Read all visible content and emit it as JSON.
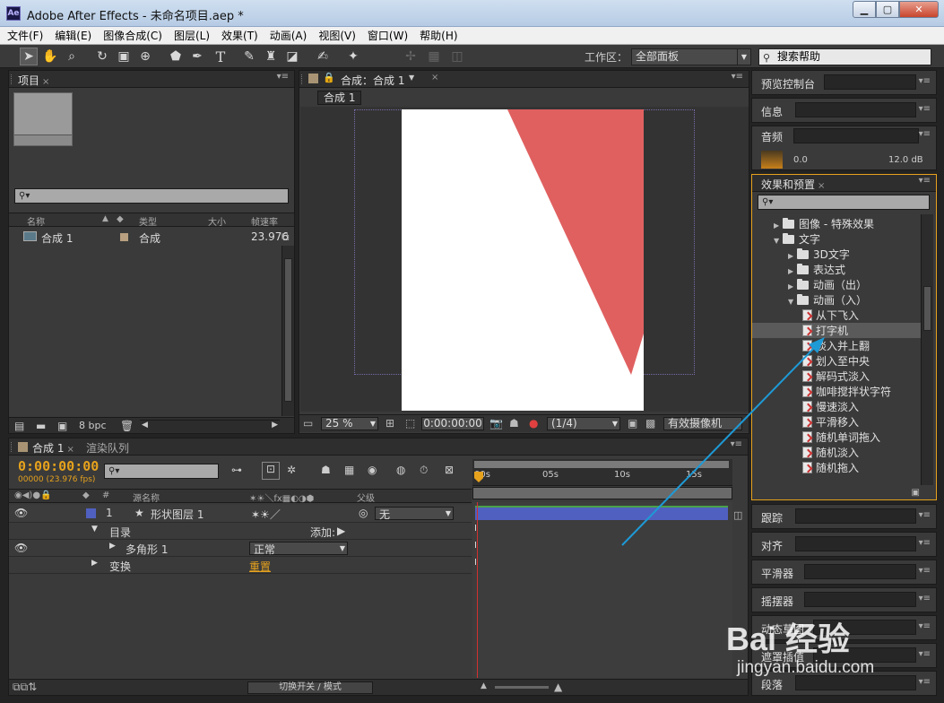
{
  "window": {
    "title": "Adobe After Effects - 未命名项目.aep *",
    "logo": "Ae",
    "min": "▁",
    "max": "▢",
    "close": "✕"
  },
  "menu": [
    "文件(F)",
    "编辑(E)",
    "图像合成(C)",
    "图层(L)",
    "效果(T)",
    "动画(A)",
    "视图(V)",
    "窗口(W)",
    "帮助(H)"
  ],
  "toolbar": {
    "workspace_label": "工作区：",
    "workspace_value": "全部面板",
    "search_help": "搜索帮助"
  },
  "project_panel": {
    "tab": "项目",
    "columns": [
      "名称",
      "类型",
      "大小",
      "帧速率"
    ],
    "items": [
      {
        "name": "合成 1",
        "type": "合成",
        "fps": "23.976"
      }
    ],
    "bpc": "8 bpc"
  },
  "comp_panel": {
    "tab": "合成：合成 1",
    "subtab": "合成 1",
    "zoom": "25 %",
    "timecode": "0:00:00:00",
    "resolution": "(1/4)",
    "camera": "有效摄像机"
  },
  "right_panels": {
    "preview": "预览控制台",
    "info": "信息",
    "audio": "音频",
    "audio_value_left": "0.0",
    "audio_value_right": "12.0 dB",
    "effects": "效果和预置",
    "tracker": "跟踪",
    "align": "对齐",
    "smoother": "平滑器",
    "wiggler": "摇摆器",
    "motion_sketch": "动态草图",
    "mask_interp": "遮罩插值",
    "paragraph": "段落"
  },
  "effects_tree": [
    {
      "label": "图像 - 特殊效果",
      "kind": "folder",
      "level": 1,
      "open": false
    },
    {
      "label": "文字",
      "kind": "folder",
      "level": 1,
      "open": true
    },
    {
      "label": "3D文字",
      "kind": "folder",
      "level": 2,
      "open": false
    },
    {
      "label": "表达式",
      "kind": "folder",
      "level": 2,
      "open": false
    },
    {
      "label": "动画（出）",
      "kind": "folder",
      "level": 2,
      "open": false
    },
    {
      "label": "动画（入）",
      "kind": "folder",
      "level": 2,
      "open": true
    },
    {
      "label": "从下飞入",
      "kind": "preset",
      "level": 3
    },
    {
      "label": "打字机",
      "kind": "preset",
      "level": 3,
      "selected": true
    },
    {
      "label": "淡入并上翻",
      "kind": "preset",
      "level": 3
    },
    {
      "label": "划入至中央",
      "kind": "preset",
      "level": 3
    },
    {
      "label": "解码式淡入",
      "kind": "preset",
      "level": 3
    },
    {
      "label": "咖啡搅拌状字符",
      "kind": "preset",
      "level": 3
    },
    {
      "label": "慢速淡入",
      "kind": "preset",
      "level": 3
    },
    {
      "label": "平滑移入",
      "kind": "preset",
      "level": 3
    },
    {
      "label": "随机单词拖入",
      "kind": "preset",
      "level": 3
    },
    {
      "label": "随机淡入",
      "kind": "preset",
      "level": 3
    },
    {
      "label": "随机拖入",
      "kind": "preset",
      "level": 3
    }
  ],
  "timeline": {
    "tab": "合成 1",
    "render_tab": "渲染队列",
    "timecode": "0:00:00:00",
    "frames_fps": "00000 (23.976 fps)",
    "col_source": "源名称",
    "col_parent": "父级",
    "layer_index": "1",
    "layer_name": "形状图层 1",
    "parent_value": "无",
    "row_contents": "目录",
    "add_label": "添加:",
    "row_polygon": "多角形 1",
    "blend_mode": "正常",
    "row_transform": "变换",
    "reset": "重置",
    "toggle_modes": "切换开关 / 模式",
    "ruler_ticks": [
      "00s",
      "05s",
      "10s",
      "15s"
    ]
  },
  "watermark": {
    "brand": "Bai 经验",
    "url": "jingyan.baidu.com"
  },
  "colors": {
    "shape_red": "#e06060",
    "accent_orange": "#e6a21d",
    "arrow_blue": "#1e9ad6",
    "layer_bar": "#5060c0"
  }
}
